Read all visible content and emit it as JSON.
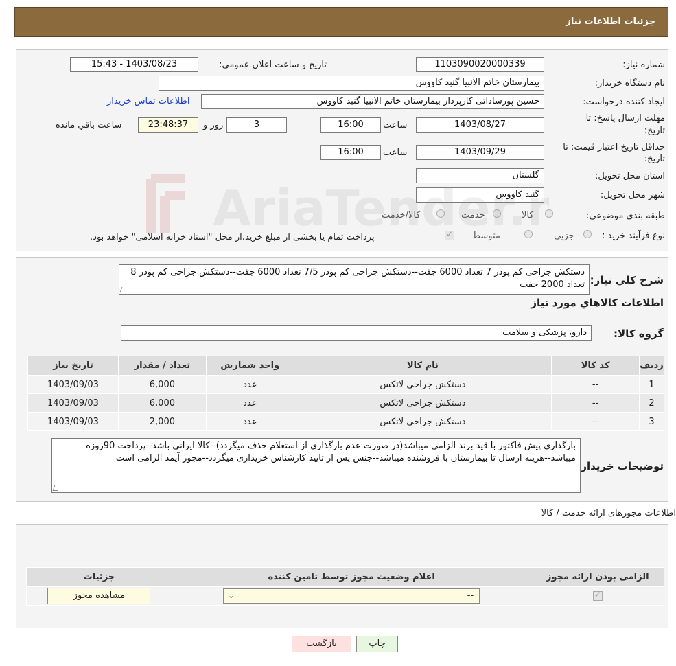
{
  "header": {
    "title": "جزئیات اطلاعات نیاز"
  },
  "form": {
    "need_number_label": "شماره نیاز:",
    "need_number": "1103090020000339",
    "announce_label": "تاریخ و ساعت اعلان عمومی:",
    "announce_value": "1403/08/23 - 15:43",
    "buyer_org_label": "نام دستگاه خریدار:",
    "buyer_org": "بیمارستان خاتم الانبیا گنبد کاووس",
    "requester_label": "ایجاد کننده درخواست:",
    "requester": "حسین پورساداتی کارپرداز بیمارستان خاتم الانبیا گنبد کاووس",
    "contact_link": "اطلاعات تماس خریدار",
    "reply_deadline_label_1": "مهلت ارسال پاسخ: تا",
    "reply_deadline_label_2": "تاریخ:",
    "reply_date": "1403/08/27",
    "time_label": "ساعت",
    "reply_time": "16:00",
    "days_value": "3",
    "days_label": "روز و",
    "remaining_time": "23:48:37",
    "remaining_label": "ساعت باقي مانده",
    "validity_label_1": "حداقل تاریخ اعتبار قیمت: تا",
    "validity_label_2": "تاریخ:",
    "validity_date": "1403/09/29",
    "validity_time_label": "ساعت",
    "validity_time": "16:00",
    "province_label": "استان محل تحویل:",
    "province": "گلستان",
    "city_label": "شهر محل تحویل:",
    "city": "گنبد کاووس",
    "category_label": "طبقه بندی موضوعی:",
    "category_options": [
      "کالا",
      "خدمت",
      "کالا/خدمت"
    ],
    "purchase_type_label": "نوع فرآیند خرید :",
    "purchase_options": [
      "جزیي",
      "متوسط"
    ],
    "purchase_note": "پرداخت تمام یا بخشی از مبلغ خرید،از محل \"اسناد خزانه اسلامی\" خواهد بود."
  },
  "summary": {
    "label": "شرح کلي نياز:",
    "text": "دستکش جراحی کم پودر 7 تعداد 6000 جفت--دستکش جراحی کم پودر 7/5 تعداد 6000 جفت--دستکش جراحی کم پودر 8 تعداد 2000 جفت",
    "goods_info_title": "اطلاعات کالاهاي مورد نياز",
    "goods_group_label": "گروه کالا:",
    "goods_group": "دارو، پزشکی و سلامت"
  },
  "items_table": {
    "headers": [
      "ردیف",
      "کد کالا",
      "نام کالا",
      "واحد شمارش",
      "تعداد / مقدار",
      "تاریخ نیاز"
    ],
    "rows": [
      [
        "1",
        "--",
        "دستکش جراحی لاتکس",
        "عدد",
        "6,000",
        "1403/09/03"
      ],
      [
        "2",
        "--",
        "دستکش جراحی لاتکس",
        "عدد",
        "6,000",
        "1403/09/03"
      ],
      [
        "3",
        "--",
        "دستکش جراحی لاتکس",
        "عدد",
        "2,000",
        "1403/09/03"
      ]
    ]
  },
  "buyer_notes": {
    "label": "توضیحات خریدار:",
    "text": "بارگذاری پیش فاکتور با قید برند الزامی میباشد(در صورت عدم بارگذاری از استعلام حذف میگردد)--کالا ایرانی باشد--پرداخت 90روزه میباشد--هزینه ارسال تا بیمارستان با فروشنده میباشد--جنس پس از تایید کارشناس خریداری میگردد--مجوز آیمد الزامی است"
  },
  "licenses": {
    "title": "اطلاعات مجوزهای ارائه خدمت / کالا",
    "headers": [
      "الزامی بودن ارائه مجوز",
      "اعلام وضعیت مجوز توسط تامین کننده",
      "جزئیات"
    ],
    "select_value": "--",
    "view_button": "مشاهده مجوز"
  },
  "buttons": {
    "print": "چاپ",
    "back": "بازگشت"
  },
  "watermark_text": "AriaTender.neT",
  "colors": {
    "header_bg": "#8b6a3e",
    "link": "#1a3fc9",
    "back_btn": "#fde0e0",
    "print_btn": "#e6f6df"
  }
}
